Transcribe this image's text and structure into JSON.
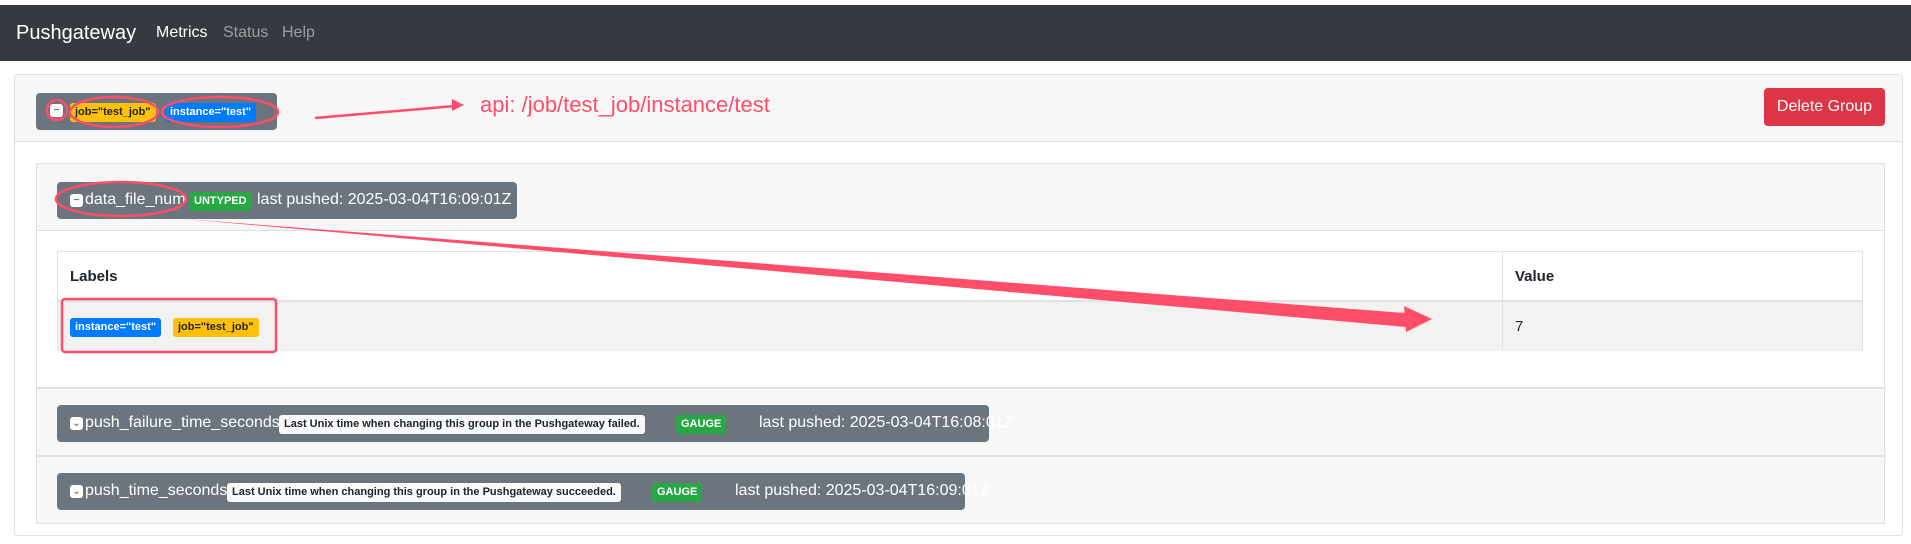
{
  "navbar": {
    "brand": "Pushgateway",
    "links": [
      {
        "label": "Metrics",
        "active": true
      },
      {
        "label": "Status",
        "active": false
      },
      {
        "label": "Help",
        "active": false
      }
    ]
  },
  "group": {
    "labels": [
      {
        "text": "job=\"test_job\"",
        "color": "#ffc107"
      },
      {
        "text": "instance=\"test\"",
        "color": "#007bff"
      }
    ],
    "delete_label": "Delete Group",
    "annotation": "api: /job/test_job/instance/test"
  },
  "metrics": [
    {
      "name": "data_file_num",
      "help": "",
      "type": "UNTYPED",
      "last_pushed": "last pushed: 2025-03-04T16:09:01Z",
      "expanded": true,
      "table": {
        "headers": [
          "Labels",
          "Value"
        ],
        "rows": [
          {
            "labels": [
              "instance=\"test\"",
              "job=\"test_job\""
            ],
            "value": "7"
          }
        ]
      }
    },
    {
      "name": "push_failure_time_seconds",
      "help": "Last Unix time when changing this group in the Pushgateway failed.",
      "type": "GAUGE",
      "last_pushed": "last pushed: 2025-03-04T16:08:01Z",
      "expanded": false
    },
    {
      "name": "push_time_seconds",
      "help": "Last Unix time when changing this group in the Pushgateway succeeded.",
      "type": "GAUGE",
      "last_pushed": "last pushed: 2025-03-04T16:09:01Z",
      "expanded": false
    }
  ],
  "colors": {
    "navbar": "#343a40",
    "danger": "#dc3545",
    "annotation": "#ff4d6a",
    "badge_gray": "#6c757d"
  },
  "icons": {
    "collapse": "minus-square-icon",
    "expand": "chevron-down-square-icon"
  }
}
